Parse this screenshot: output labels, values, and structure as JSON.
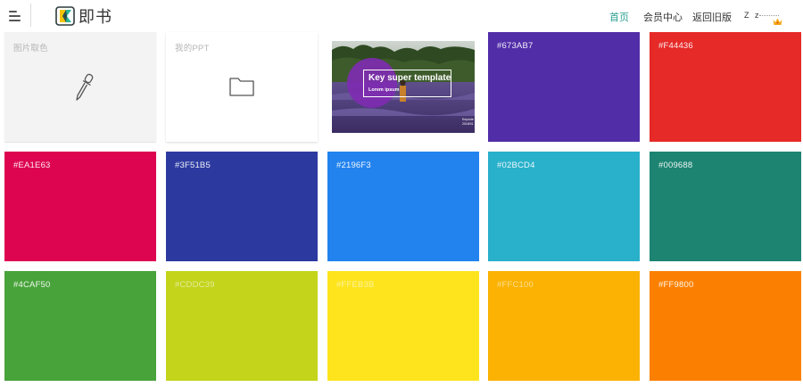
{
  "header": {
    "brand_name": "即书",
    "nav": {
      "home": "首页",
      "member_center": "会员中心",
      "old_version": "返回旧版"
    },
    "user_name": "Z z",
    "crown_icon": "crown-icon"
  },
  "tools": {
    "picker_label": "图片取色",
    "picker_icon": "eyedropper-icon",
    "my_ppt_label": "我的PPT",
    "folder_icon": "folder-icon"
  },
  "template_preview": {
    "title": "Key super template",
    "subtitle": "Lorem ipsum",
    "corner_line1": "Keynote",
    "corner_line2": "2018/01"
  },
  "swatches": [
    {
      "label": "#673AB7",
      "color": "#512da8"
    },
    {
      "label": "#F44436",
      "color": "#e52a28"
    },
    {
      "label": "#EA1E63",
      "color": "#dd0550"
    },
    {
      "label": "#3F51B5",
      "color": "#2c3aa0"
    },
    {
      "label": "#2196F3",
      "color": "#2283ee"
    },
    {
      "label": "#02BCD4",
      "color": "#29b0cb"
    },
    {
      "label": "#009688",
      "color": "#1d8472"
    },
    {
      "label": "#4CAF50",
      "color": "#48a33a"
    },
    {
      "label": "#CDDC39",
      "color": "#c3d41b"
    },
    {
      "label": "#FFEB3B",
      "color": "#fde41d"
    },
    {
      "label": "#FFC100",
      "color": "#fbb202"
    },
    {
      "label": "#FF9800",
      "color": "#fb8001"
    }
  ]
}
